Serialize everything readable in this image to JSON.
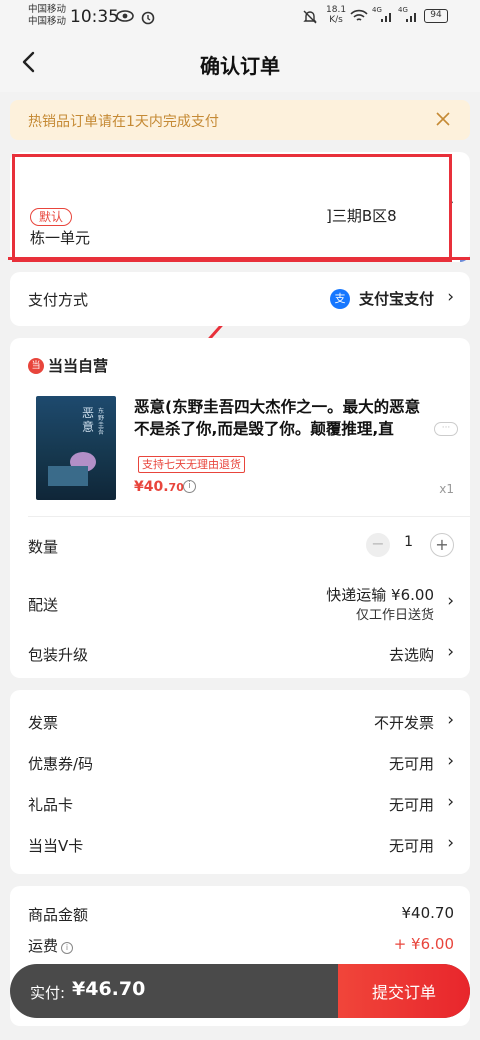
{
  "status_bar": {
    "carrier1": "中国移动",
    "carrier2": "中国移动",
    "time": "10:35",
    "net_speed_value": "18.1",
    "net_speed_unit": "K/s",
    "signal1": "4G",
    "signal2": "4G",
    "battery": "94"
  },
  "header": {
    "title": "确认订单"
  },
  "notice": {
    "text": "热销品订单请在1天内完成支付"
  },
  "address": {
    "badge": "默认",
    "line1": "]三期B区8",
    "line2": "栋一单元"
  },
  "payment": {
    "label": "支付方式",
    "method": "支付宝支付",
    "icon_glyph": "支"
  },
  "shop": {
    "icon_glyph": "当",
    "name": "当当自营"
  },
  "product": {
    "cover_title": "恶意",
    "cover_author": "东野圭吾",
    "title": "恶意(东野圭吾四大杰作之一。最大的恶意不是杀了你,而是毁了你。颠覆推理,直",
    "more": "···",
    "tag": "支持七天无理由退货",
    "price_prefix": "¥40.",
    "price_decimal": "70",
    "quantity_label": "x1"
  },
  "quantity": {
    "label": "数量",
    "value": "1",
    "minus": "−",
    "plus": "+"
  },
  "delivery": {
    "label": "配送",
    "value": "快递运输 ¥6.00",
    "sub": "仅工作日送货"
  },
  "packaging": {
    "label": "包装升级",
    "value": "去选购"
  },
  "invoice": {
    "label": "发票",
    "value": "不开发票"
  },
  "coupon": {
    "label": "优惠券/码",
    "value": "无可用"
  },
  "gift_card": {
    "label": "礼品卡",
    "value": "无可用"
  },
  "vcard": {
    "label": "当当V卡",
    "value": "无可用"
  },
  "totals": {
    "goods_label": "商品金额",
    "goods_value": "¥40.70",
    "shipping_label": "运费",
    "shipping_value": "+ ¥6.00"
  },
  "footer": {
    "pay_label": "实付:",
    "total": "¥46.70",
    "submit": "提交订单"
  },
  "colors": {
    "accent": "#e8453c",
    "notice_bg": "#fdf1dc",
    "notice_text": "#c58a35",
    "alipay": "#1677ff"
  },
  "icons": [
    "back-arrow-icon",
    "eye-icon",
    "alarm-icon",
    "mute-icon",
    "wifi-icon",
    "signal-icon",
    "close-icon",
    "chevron-right-icon",
    "alipay-icon",
    "shop-icon",
    "info-icon"
  ]
}
